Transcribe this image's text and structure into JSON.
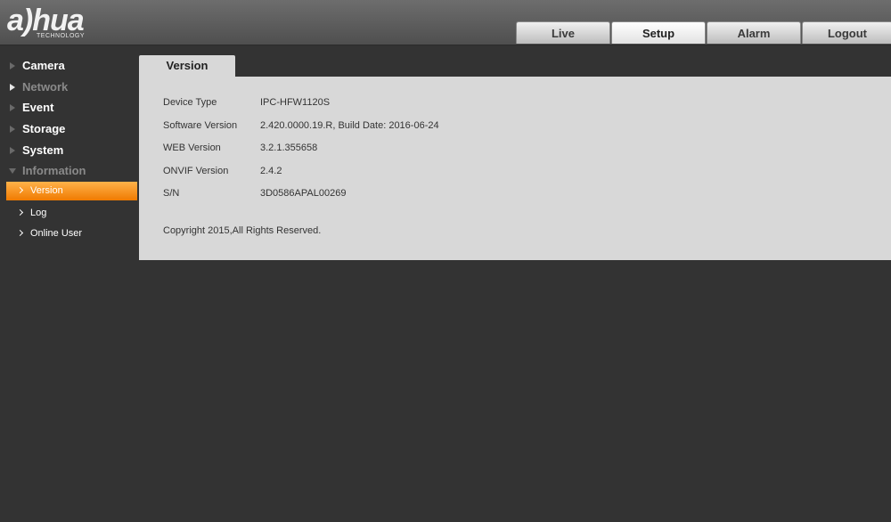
{
  "brand": {
    "logo_text": "a)hua",
    "logo_subtext": "TECHNOLOGY"
  },
  "top_tabs": [
    {
      "label": "Live"
    },
    {
      "label": "Setup",
      "active": true
    },
    {
      "label": "Alarm"
    },
    {
      "label": "Logout"
    }
  ],
  "sidebar": {
    "items": [
      {
        "label": "Camera"
      },
      {
        "label": "Network"
      },
      {
        "label": "Event"
      },
      {
        "label": "Storage"
      },
      {
        "label": "System"
      },
      {
        "label": "Information",
        "expanded": true
      }
    ],
    "sub_items": [
      {
        "label": "Version",
        "active": true
      },
      {
        "label": "Log"
      },
      {
        "label": "Online User"
      }
    ]
  },
  "panel": {
    "tab_label": "Version",
    "rows": [
      {
        "key": "Device Type",
        "value": "IPC-HFW1120S"
      },
      {
        "key": "Software Version",
        "value": "2.420.0000.19.R, Build Date: 2016-06-24"
      },
      {
        "key": "WEB Version",
        "value": "3.2.1.355658"
      },
      {
        "key": "ONVIF Version",
        "value": "2.4.2"
      },
      {
        "key": "S/N",
        "value": "3D0586APAL00269"
      }
    ],
    "copyright": "Copyright 2015,All Rights Reserved."
  },
  "colors": {
    "accent": "#f28a10",
    "background": "#333333",
    "panel": "#d8d8d8"
  }
}
